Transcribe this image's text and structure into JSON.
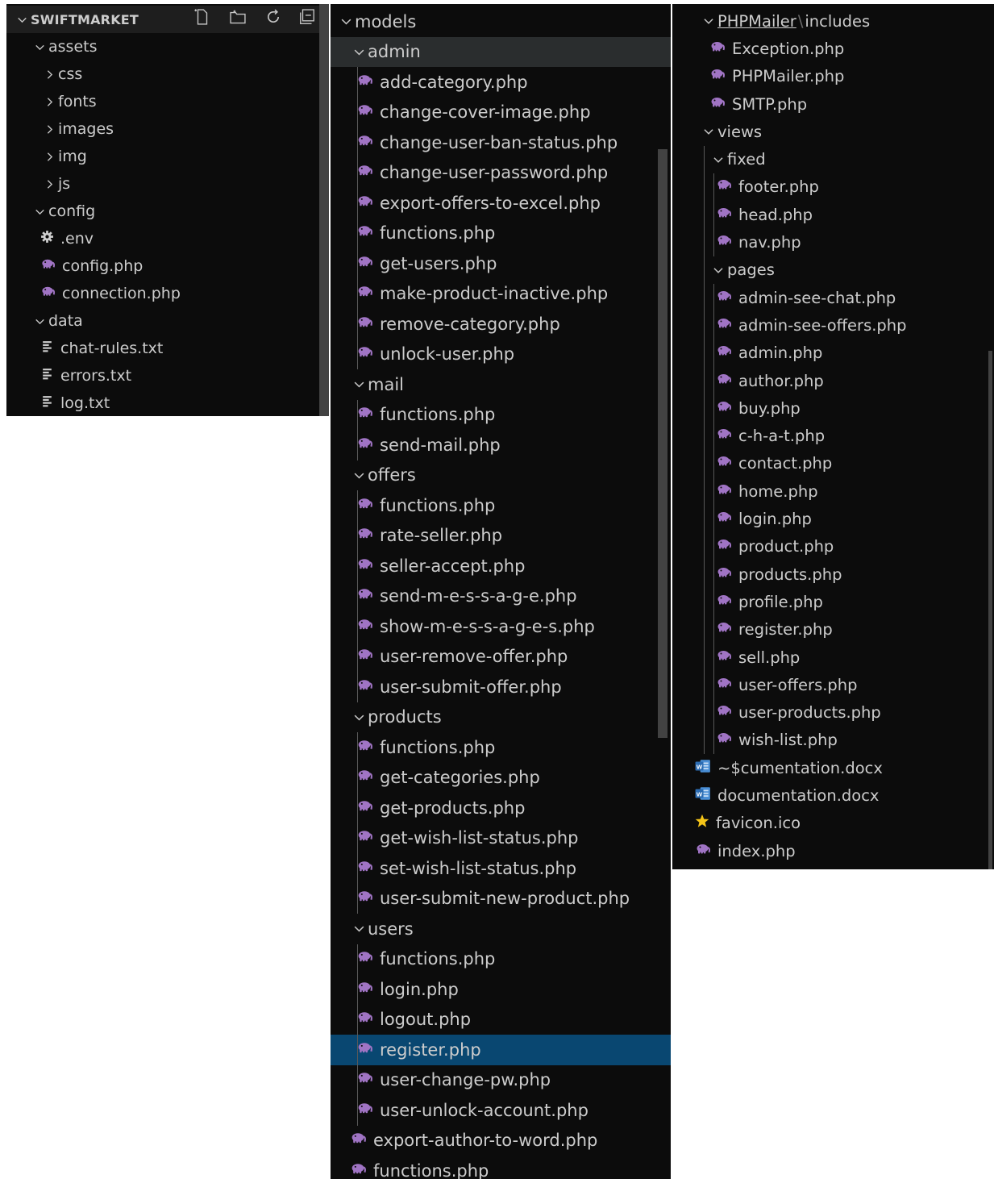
{
  "panels": [
    {
      "id": "p1",
      "rows": [
        {
          "label": "SWIFTMARKET",
          "kind": "header",
          "depth": 0,
          "expanded": true
        },
        {
          "label": "assets",
          "kind": "folder",
          "depth": 1,
          "expanded": true
        },
        {
          "label": "css",
          "kind": "folder",
          "depth": 2,
          "expanded": false
        },
        {
          "label": "fonts",
          "kind": "folder",
          "depth": 2,
          "expanded": false
        },
        {
          "label": "images",
          "kind": "folder",
          "depth": 2,
          "expanded": false
        },
        {
          "label": "img",
          "kind": "folder",
          "depth": 2,
          "expanded": false
        },
        {
          "label": "js",
          "kind": "folder",
          "depth": 2,
          "expanded": false
        },
        {
          "label": "config",
          "kind": "folder",
          "depth": 1,
          "expanded": true
        },
        {
          "label": ".env",
          "kind": "file",
          "icon": "gear-icon",
          "depth": 2
        },
        {
          "label": "config.php",
          "kind": "file",
          "icon": "php-icon",
          "depth": 2
        },
        {
          "label": "connection.php",
          "kind": "file",
          "icon": "php-icon",
          "depth": 2
        },
        {
          "label": "data",
          "kind": "folder",
          "depth": 1,
          "expanded": true
        },
        {
          "label": "chat-rules.txt",
          "kind": "file",
          "icon": "text-file-icon",
          "depth": 2
        },
        {
          "label": "errors.txt",
          "kind": "file",
          "icon": "text-file-icon",
          "depth": 2
        },
        {
          "label": "log.txt",
          "kind": "file",
          "icon": "text-file-icon",
          "depth": 2
        }
      ],
      "toolbar": [
        "new-file-icon",
        "new-folder-icon",
        "refresh-icon",
        "collapse-all-icon"
      ]
    },
    {
      "id": "p2",
      "rows": [
        {
          "label": "models",
          "kind": "folder",
          "depth": 0,
          "expanded": true
        },
        {
          "label": "admin",
          "kind": "folder",
          "depth": 1,
          "expanded": true,
          "state": "hovered"
        },
        {
          "label": "add-category.php",
          "kind": "file",
          "icon": "php-icon",
          "depth": 2
        },
        {
          "label": "change-cover-image.php",
          "kind": "file",
          "icon": "php-icon",
          "depth": 2
        },
        {
          "label": "change-user-ban-status.php",
          "kind": "file",
          "icon": "php-icon",
          "depth": 2
        },
        {
          "label": "change-user-password.php",
          "kind": "file",
          "icon": "php-icon",
          "depth": 2
        },
        {
          "label": "export-offers-to-excel.php",
          "kind": "file",
          "icon": "php-icon",
          "depth": 2
        },
        {
          "label": "functions.php",
          "kind": "file",
          "icon": "php-icon",
          "depth": 2
        },
        {
          "label": "get-users.php",
          "kind": "file",
          "icon": "php-icon",
          "depth": 2
        },
        {
          "label": "make-product-inactive.php",
          "kind": "file",
          "icon": "php-icon",
          "depth": 2
        },
        {
          "label": "remove-category.php",
          "kind": "file",
          "icon": "php-icon",
          "depth": 2
        },
        {
          "label": "unlock-user.php",
          "kind": "file",
          "icon": "php-icon",
          "depth": 2
        },
        {
          "label": "mail",
          "kind": "folder",
          "depth": 1,
          "expanded": true
        },
        {
          "label": "functions.php",
          "kind": "file",
          "icon": "php-icon",
          "depth": 2
        },
        {
          "label": "send-mail.php",
          "kind": "file",
          "icon": "php-icon",
          "depth": 2
        },
        {
          "label": "offers",
          "kind": "folder",
          "depth": 1,
          "expanded": true
        },
        {
          "label": "functions.php",
          "kind": "file",
          "icon": "php-icon",
          "depth": 2
        },
        {
          "label": "rate-seller.php",
          "kind": "file",
          "icon": "php-icon",
          "depth": 2
        },
        {
          "label": "seller-accept.php",
          "kind": "file",
          "icon": "php-icon",
          "depth": 2
        },
        {
          "label": "send-m-e-s-s-a-g-e.php",
          "kind": "file",
          "icon": "php-icon",
          "depth": 2
        },
        {
          "label": "show-m-e-s-s-a-g-e-s.php",
          "kind": "file",
          "icon": "php-icon",
          "depth": 2
        },
        {
          "label": "user-remove-offer.php",
          "kind": "file",
          "icon": "php-icon",
          "depth": 2
        },
        {
          "label": "user-submit-offer.php",
          "kind": "file",
          "icon": "php-icon",
          "depth": 2
        },
        {
          "label": "products",
          "kind": "folder",
          "depth": 1,
          "expanded": true
        },
        {
          "label": "functions.php",
          "kind": "file",
          "icon": "php-icon",
          "depth": 2
        },
        {
          "label": "get-categories.php",
          "kind": "file",
          "icon": "php-icon",
          "depth": 2
        },
        {
          "label": "get-products.php",
          "kind": "file",
          "icon": "php-icon",
          "depth": 2
        },
        {
          "label": "get-wish-list-status.php",
          "kind": "file",
          "icon": "php-icon",
          "depth": 2
        },
        {
          "label": "set-wish-list-status.php",
          "kind": "file",
          "icon": "php-icon",
          "depth": 2
        },
        {
          "label": "user-submit-new-product.php",
          "kind": "file",
          "icon": "php-icon",
          "depth": 2
        },
        {
          "label": "users",
          "kind": "folder",
          "depth": 1,
          "expanded": true
        },
        {
          "label": "functions.php",
          "kind": "file",
          "icon": "php-icon",
          "depth": 2
        },
        {
          "label": "login.php",
          "kind": "file",
          "icon": "php-icon",
          "depth": 2
        },
        {
          "label": "logout.php",
          "kind": "file",
          "icon": "php-icon",
          "depth": 2
        },
        {
          "label": "register.php",
          "kind": "file",
          "icon": "php-icon",
          "depth": 2,
          "state": "selected"
        },
        {
          "label": "user-change-pw.php",
          "kind": "file",
          "icon": "php-icon",
          "depth": 2
        },
        {
          "label": "user-unlock-account.php",
          "kind": "file",
          "icon": "php-icon",
          "depth": 2
        },
        {
          "label": "export-author-to-word.php",
          "kind": "file",
          "icon": "php-icon",
          "depth": 1
        },
        {
          "label": "functions.php",
          "kind": "file",
          "icon": "php-icon",
          "depth": 1
        }
      ]
    },
    {
      "id": "p3",
      "rows": [
        {
          "label": "PHPMailer",
          "label2": "includes",
          "kind": "folder",
          "depth": 1,
          "expanded": true,
          "state": "header"
        },
        {
          "label": "Exception.php",
          "kind": "file",
          "icon": "php-icon",
          "depth": 2
        },
        {
          "label": "PHPMailer.php",
          "kind": "file",
          "icon": "php-icon",
          "depth": 2
        },
        {
          "label": "SMTP.php",
          "kind": "file",
          "icon": "php-icon",
          "depth": 2
        },
        {
          "label": "views",
          "kind": "folder",
          "depth": 1,
          "expanded": true
        },
        {
          "label": "fixed",
          "kind": "folder",
          "depth": 2,
          "expanded": true
        },
        {
          "label": "footer.php",
          "kind": "file",
          "icon": "php-icon",
          "depth": 3
        },
        {
          "label": "head.php",
          "kind": "file",
          "icon": "php-icon",
          "depth": 3
        },
        {
          "label": "nav.php",
          "kind": "file",
          "icon": "php-icon",
          "depth": 3
        },
        {
          "label": "pages",
          "kind": "folder",
          "depth": 2,
          "expanded": true
        },
        {
          "label": "admin-see-chat.php",
          "kind": "file",
          "icon": "php-icon",
          "depth": 3
        },
        {
          "label": "admin-see-offers.php",
          "kind": "file",
          "icon": "php-icon",
          "depth": 3
        },
        {
          "label": "admin.php",
          "kind": "file",
          "icon": "php-icon",
          "depth": 3
        },
        {
          "label": "author.php",
          "kind": "file",
          "icon": "php-icon",
          "depth": 3
        },
        {
          "label": "buy.php",
          "kind": "file",
          "icon": "php-icon",
          "depth": 3
        },
        {
          "label": "c-h-a-t.php",
          "kind": "file",
          "icon": "php-icon",
          "depth": 3
        },
        {
          "label": "contact.php",
          "kind": "file",
          "icon": "php-icon",
          "depth": 3
        },
        {
          "label": "home.php",
          "kind": "file",
          "icon": "php-icon",
          "depth": 3
        },
        {
          "label": "login.php",
          "kind": "file",
          "icon": "php-icon",
          "depth": 3
        },
        {
          "label": "product.php",
          "kind": "file",
          "icon": "php-icon",
          "depth": 3
        },
        {
          "label": "products.php",
          "kind": "file",
          "icon": "php-icon",
          "depth": 3
        },
        {
          "label": "profile.php",
          "kind": "file",
          "icon": "php-icon",
          "depth": 3
        },
        {
          "label": "register.php",
          "kind": "file",
          "icon": "php-icon",
          "depth": 3
        },
        {
          "label": "sell.php",
          "kind": "file",
          "icon": "php-icon",
          "depth": 3
        },
        {
          "label": "user-offers.php",
          "kind": "file",
          "icon": "php-icon",
          "depth": 3
        },
        {
          "label": "user-products.php",
          "kind": "file",
          "icon": "php-icon",
          "depth": 3
        },
        {
          "label": "wish-list.php",
          "kind": "file",
          "icon": "php-icon",
          "depth": 3
        },
        {
          "label": "~$cumentation.docx",
          "kind": "file",
          "icon": "word-icon",
          "depth": 0
        },
        {
          "label": "documentation.docx",
          "kind": "file",
          "icon": "word-icon",
          "depth": 0
        },
        {
          "label": "favicon.ico",
          "kind": "file",
          "icon": "star-icon",
          "depth": 0
        },
        {
          "label": "index.php",
          "kind": "file",
          "icon": "php-icon",
          "depth": 0
        }
      ]
    }
  ],
  "colors": {
    "background": "#0c0c0c",
    "text": "#cccccc",
    "php_icon": "#a074c4",
    "selected_row": "#094771",
    "hovered_row": "#2a2d2e",
    "word_icon": "#4a8fd6",
    "star_icon": "#f5c518"
  }
}
